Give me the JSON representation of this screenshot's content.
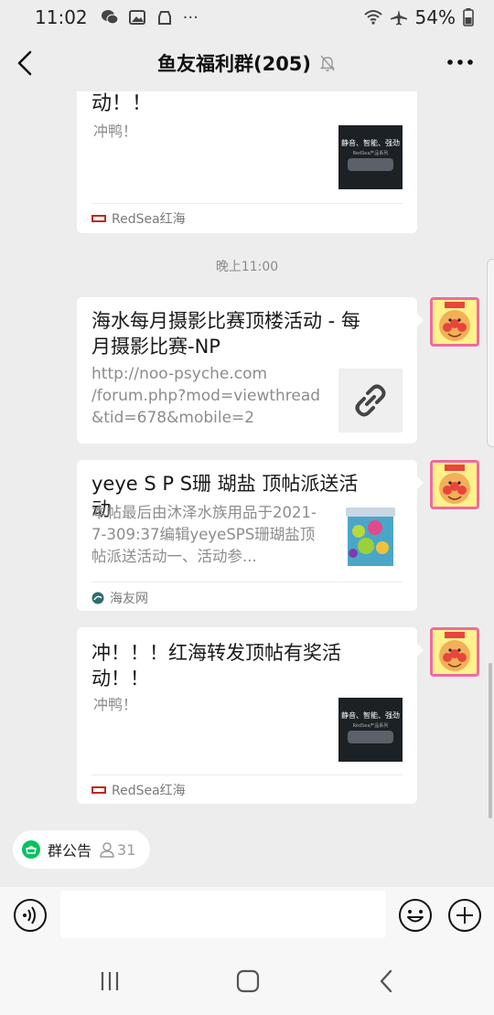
{
  "status_bar": {
    "time": "11:02",
    "more": "···",
    "battery": "54%"
  },
  "header": {
    "title": "鱼友福利群(205)"
  },
  "messages": [
    {
      "title_tail": "动！！",
      "desc": "冲鸭！",
      "thumb_line1": "静音、智能、强劲",
      "thumb_line2": "RedSea产品系列",
      "source": "RedSea红海"
    },
    {
      "title": "海水每月摄影比赛顶楼活动 - 每月摄影比赛-NP",
      "url_lines": [
        "http://noo-psyche.com",
        "/forum.php?mod=viewthread",
        "&tid=678&mobile=2"
      ]
    },
    {
      "title": "yeye S P S珊 瑚盐 顶帖派送活动",
      "desc": "本帖最后由沐泽水族用品于2021-7-309:37编辑yeyeSPS珊瑚盐顶帖派送活动一、活动参...",
      "source": "海友网"
    },
    {
      "title": "冲！！！红海转发顶帖有奖活动！！",
      "desc": "冲鸭！",
      "thumb_line1": "静音、智能、强劲",
      "thumb_line2": "RedSea产品系列",
      "source": "RedSea红海"
    }
  ],
  "timestamp": "晚上11:00",
  "announcement": {
    "label": "群公告",
    "count": "31"
  },
  "colors": {
    "background": "#ededed",
    "card": "#ffffff",
    "announce_green": "#07c160"
  }
}
